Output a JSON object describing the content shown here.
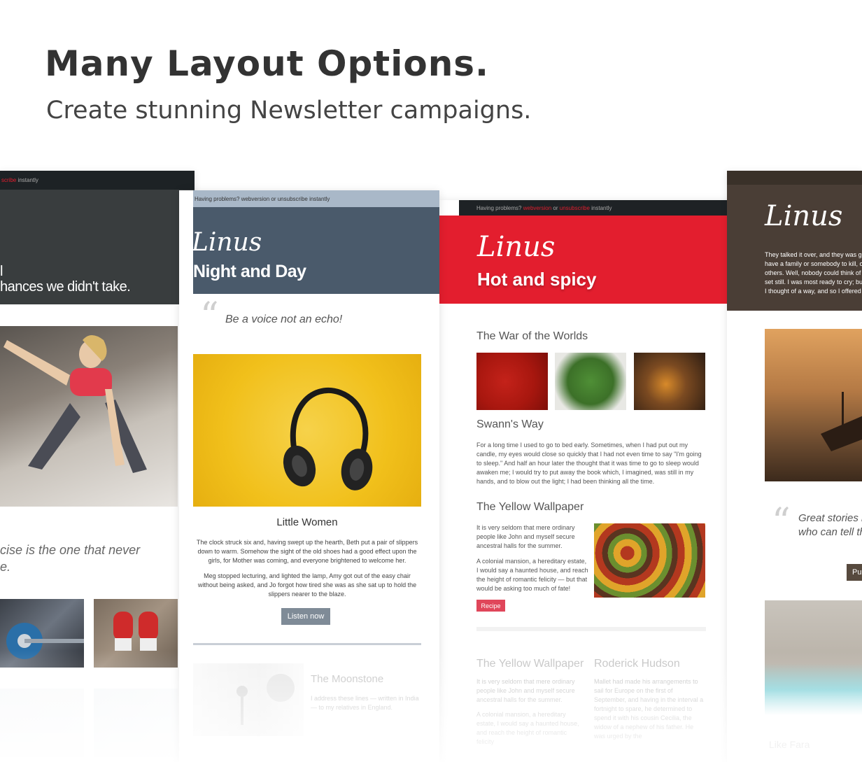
{
  "header": {
    "title": "Many Layout Options.",
    "subtitle": "Create stunning Newsletter campaigns."
  },
  "card1": {
    "topbar_text": "scribe instantly",
    "hero_line1": "l",
    "hero_line2": "hances we didn't take.",
    "quote": "cise is the one that never",
    "quote2": "e."
  },
  "card2": {
    "topbar_text": "Having problems? webversion or unsubscribe instantly",
    "logo": "Linus",
    "hero_title": "Night and Day",
    "quote": "Be a voice not an echo!",
    "article_title": "Little Women",
    "para1": "The clock struck six and, having swept up the hearth, Beth put a pair of slippers down to warm. Somehow the sight of the old shoes had a good effect upon the girls, for Mother was coming, and everyone brightened to welcome her.",
    "para2": "Meg stopped lecturing, and lighted the lamp, Amy got out of the easy chair without being asked, and Jo forgot how tired she was as she sat up to hold the slippers nearer to the blaze.",
    "button": "Listen now",
    "moonstone_title": "The Moonstone",
    "moonstone_text": "I address these lines — written in India — to my relatives in England."
  },
  "card3": {
    "topbar_prefix": "Having problems?",
    "topbar_link1": "webversion",
    "topbar_or": "or",
    "topbar_link2": "unsubscribe",
    "topbar_suffix": "instantly",
    "logo": "Linus",
    "hero_title": "Hot and spicy",
    "section1_title": "The War of the Worlds",
    "section2_title": "Swann's Way",
    "section2_text": "For a long time I used to go to bed early. Sometimes, when I had put out my candle, my eyes would close so quickly that I had not even time to say \"I'm going to sleep.\" And half an hour later the thought that it was time to go to sleep would awaken me; I would try to put away the book which, I imagined, was still in my hands, and to blow out the light; I had been thinking all the time.",
    "section3_title": "The Yellow Wallpaper",
    "section3_text1": "It is very seldom that mere ordinary people like John and myself secure ancestral halls for the summer.",
    "section3_text2": "A colonial mansion, a hereditary estate, I would say a haunted house, and reach the height of romantic felicity — but that would be asking too much of fate!",
    "button": "Recipe",
    "bottom_left_title": "The Yellow Wallpaper",
    "bottom_left_text1": "It is very seldom that mere ordinary people like John and myself secure ancestral halls for the summer.",
    "bottom_left_text2": "A colonial mansion, a hereditary estate, I would say a haunted house, and reach the height of romantic felicity",
    "bottom_right_title": "Roderick Hudson",
    "bottom_right_text": "Mallet had made his arrangements to sail for Europe on the first of September, and having in the interval a fortnight to spare, he determined to spend it with his cousin Cecilia, the widow of a nephew of his father. He was urged by the",
    "colors": {
      "accent": "#e31e2e",
      "topbar": "#1e2225"
    }
  },
  "card4": {
    "logo": "Linus",
    "intro": "They talked it over, and they was going to must have a family or somebody to kill, or else it others.  Well, nobody could think of anything to set still.  I was most ready to cry; but all at once I thought of a way, and so I offered them Miss Watson — they could kill her.",
    "quote_line1": "Great stories h",
    "quote_line2": "who can tell th",
    "button": "Pu",
    "footer_text": "Like Fara"
  }
}
